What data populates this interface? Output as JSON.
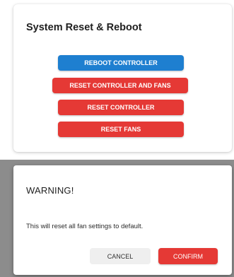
{
  "card": {
    "title": "System Reset & Reboot",
    "buttons": {
      "reboot_controller": "REBOOT CONTROLLER",
      "reset_controller_and_fans": "RESET CONTROLLER AND FANS",
      "reset_controller": "RESET CONTROLLER",
      "reset_fans": "RESET FANS"
    }
  },
  "dialog": {
    "title": "WARNING!",
    "message": "This will reset all fan settings to default.",
    "cancel_label": "CANCEL",
    "confirm_label": "CONFIRM"
  },
  "colors": {
    "primary_blue": "#1e7fd0",
    "danger_red": "#e53935",
    "backdrop": "#8c8c8c"
  }
}
